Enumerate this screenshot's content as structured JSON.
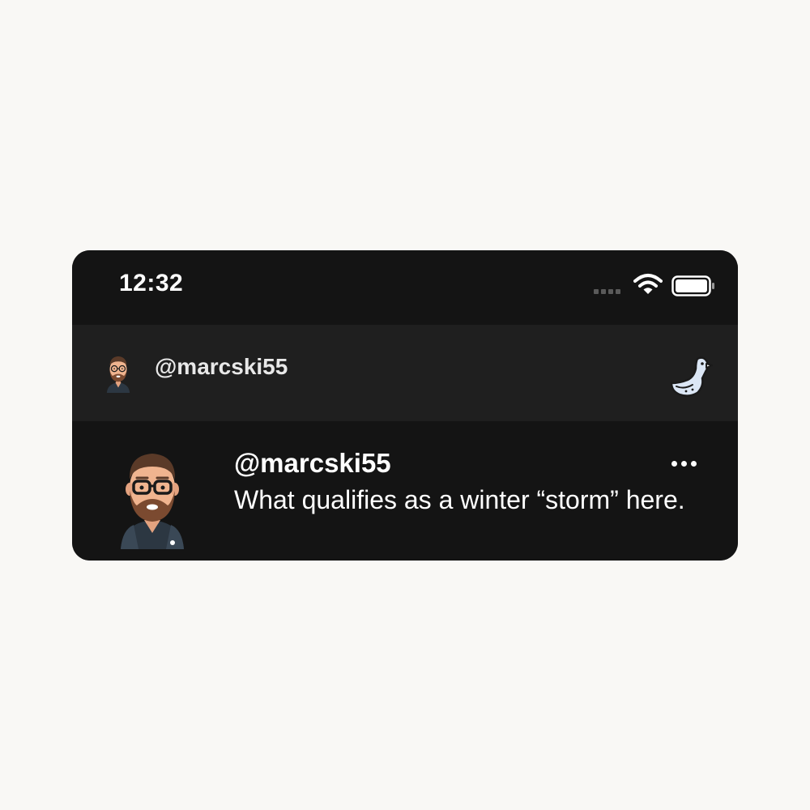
{
  "status_bar": {
    "time": "12:32",
    "icons": [
      "signal-dots-icon",
      "wifi-icon",
      "battery-icon"
    ]
  },
  "nav_bar": {
    "username": "@marcski55",
    "avatar_icon": "user-avatar-icon",
    "logo_icon": "goose-logo-icon"
  },
  "post": {
    "username": "@marcski55",
    "text": "What qualifies as a winter “storm” here.",
    "more_icon": "more-options-icon"
  },
  "colors": {
    "page_background": "#f9f8f5",
    "card_background": "#141414",
    "nav_background": "#1f1f1f",
    "text": "#ffffff",
    "logo_fill": "#dbe6f5"
  }
}
